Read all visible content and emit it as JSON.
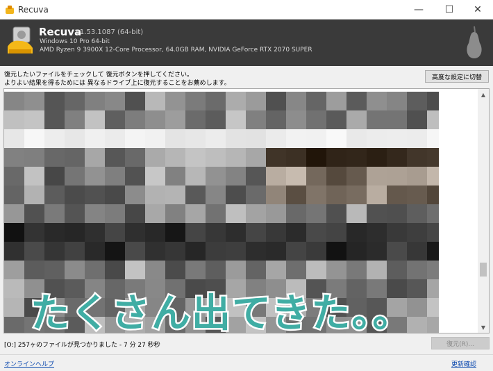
{
  "window": {
    "title": "Recuva",
    "minimize": "—",
    "maximize": "☐",
    "close": "✕"
  },
  "header": {
    "app_name": "Recuva",
    "version": "v1.53.1087 (64-bit)",
    "os": "Windows 10 Pro 64-bit",
    "hardware": "AMD Ryzen 9 3900X 12-Core Processor, 64.0GB RAM, NVIDIA GeForce RTX 2070 SUPER"
  },
  "instructions": {
    "line1": "復元したいファイルをチェックして 復元ボタンを押してください。",
    "line2": "よりよい結果を得るためには 異なるドライブ上に復元することをお薦めします。",
    "advanced_button": "高度な設定に切替"
  },
  "overlay": {
    "text": "たくさん出てきた。。"
  },
  "status": {
    "text": "[O:] 257ヶのファイルが見つかりました - 7 分 27 秒秒",
    "restore_button": "復元(R)..."
  },
  "footer": {
    "help_link": "オンラインヘルプ",
    "update_link": "更新確認"
  },
  "scrollbar": {
    "up_arrow": "▲",
    "down_arrow": "▼"
  },
  "colors": {
    "header_bg": "#3a3a3a",
    "overlay_text": "#40ada4",
    "link": "#0645ad"
  }
}
